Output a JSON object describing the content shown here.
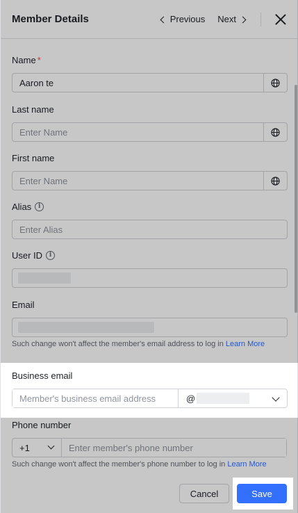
{
  "header": {
    "title": "Member Details",
    "previous_label": "Previous",
    "next_label": "Next"
  },
  "form": {
    "name": {
      "label": "Name",
      "required_mark": "*",
      "value": "Aaron te"
    },
    "last_name": {
      "label": "Last name",
      "placeholder": "Enter Name"
    },
    "first_name": {
      "label": "First name",
      "placeholder": "Enter Name"
    },
    "alias": {
      "label": "Alias",
      "placeholder": "Enter Alias"
    },
    "user_id": {
      "label": "User ID"
    },
    "email": {
      "label": "Email",
      "help_text": "Such change won't affect the member's email address to log in",
      "help_link": "Learn More"
    },
    "business_email": {
      "label": "Business email",
      "placeholder": "Member's business email address",
      "domain_prefix": "@"
    },
    "phone": {
      "label": "Phone number",
      "country_code": "+1",
      "placeholder": "Enter member's phone number",
      "help_text": "Such change won't affect the member's phone number to log in",
      "help_link": "Learn More"
    }
  },
  "footer": {
    "cancel_label": "Cancel",
    "save_label": "Save"
  },
  "colors": {
    "accent": "#3370ff",
    "required": "#f54a45",
    "border": "#d0d3d6"
  },
  "icons": {
    "globe": "globe-icon",
    "info": "info-icon",
    "close": "close-icon"
  }
}
